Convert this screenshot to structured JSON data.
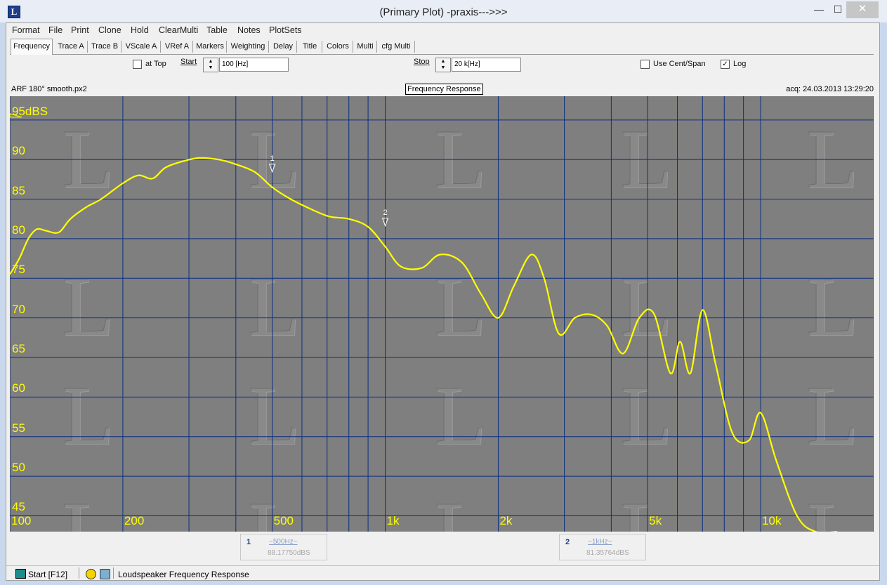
{
  "window": {
    "title": "(Primary Plot) -praxis--->>>",
    "app_icon": "L",
    "min_glyph": "—",
    "max_glyph": "☐",
    "close_glyph": "✕"
  },
  "menu": [
    "Format",
    "File",
    "Print",
    "Clone",
    "Hold",
    "ClearMulti",
    "Table",
    "Notes",
    "PlotSets"
  ],
  "tabs": [
    "Frequency",
    "Trace A",
    "Trace B",
    "VScale A",
    "VRef A",
    "Markers",
    "Weighting",
    "Delay",
    "Title",
    "Colors",
    "Multi",
    "cfg Multi"
  ],
  "toolbar": {
    "at_top_label": "at Top",
    "start_label": "Start",
    "start_value": "100 [Hz]",
    "stop_label": "Stop",
    "stop_value": "20 k[Hz]",
    "use_cent_span_label": "Use Cent/Span",
    "log_label": "Log",
    "log_checked": true,
    "at_top_checked": false,
    "use_cent_span_checked": false
  },
  "plot": {
    "file_name": "ARF 180° smooth.px2",
    "title": "Frequency Response",
    "acq": "acq: 24.03.2013 13:29:20",
    "marker1_label": "1",
    "marker2_label": "2"
  },
  "chart_data": {
    "type": "line",
    "title": "Frequency Response",
    "xscale": "log",
    "xlim": [
      100,
      20000
    ],
    "ylim": [
      43,
      98
    ],
    "x_tick_labels": [
      "100",
      "200",
      "500",
      "1k",
      "2k",
      "5k",
      "10k"
    ],
    "x_tick_values": [
      100,
      200,
      500,
      1000,
      2000,
      5000,
      10000
    ],
    "y_tick_labels": [
      "95dBS",
      "90",
      "85",
      "80",
      "75",
      "70",
      "65",
      "60",
      "55",
      "50",
      "45"
    ],
    "y_tick_values": [
      95,
      90,
      85,
      80,
      75,
      70,
      65,
      60,
      55,
      50,
      45
    ],
    "grid": true,
    "line_color": "#ffff00",
    "series": [
      {
        "x": [
          100,
          106,
          112,
          118,
          125,
          135,
          145,
          160,
          175,
          200,
          220,
          240,
          260,
          290,
          320,
          360,
          400,
          450,
          500,
          560,
          630,
          710,
          800,
          900,
          1000,
          1100,
          1250,
          1400,
          1600,
          1800,
          2000,
          2200,
          2450,
          2650,
          2900,
          3200,
          3550,
          3900,
          4300,
          4750,
          5200,
          5750,
          6100,
          6500,
          7000,
          7600,
          8400,
          9300,
          10000,
          11000,
          12500,
          14000,
          16000
        ],
        "y": [
          75.5,
          77.5,
          80,
          81.2,
          81.0,
          80.8,
          82.5,
          84,
          85,
          87,
          88,
          87.6,
          89,
          89.8,
          90.2,
          90,
          89.4,
          88.4,
          86.5,
          85,
          83.8,
          82.8,
          82.5,
          81.5,
          79,
          76.5,
          76.3,
          78,
          77,
          73,
          70,
          74,
          78,
          75,
          68,
          70,
          70.4,
          69,
          65.5,
          70,
          70.5,
          63,
          67,
          63,
          71,
          64,
          55.5,
          54.5,
          58,
          52,
          45,
          43,
          43
        ]
      }
    ],
    "markers": [
      {
        "label": "1",
        "x": 500,
        "y": 88.1775
      },
      {
        "label": "2",
        "x": 1000,
        "y": 81.35764
      }
    ]
  },
  "readouts": [
    {
      "num": "1",
      "freq": "~500Hz~",
      "value": "88.17750dBS"
    },
    {
      "num": "2",
      "freq": "~1kHz~",
      "value": "81.35764dBS"
    }
  ],
  "status": {
    "start_label": "Start [F12]",
    "text": "Loudspeaker Frequency Response"
  }
}
